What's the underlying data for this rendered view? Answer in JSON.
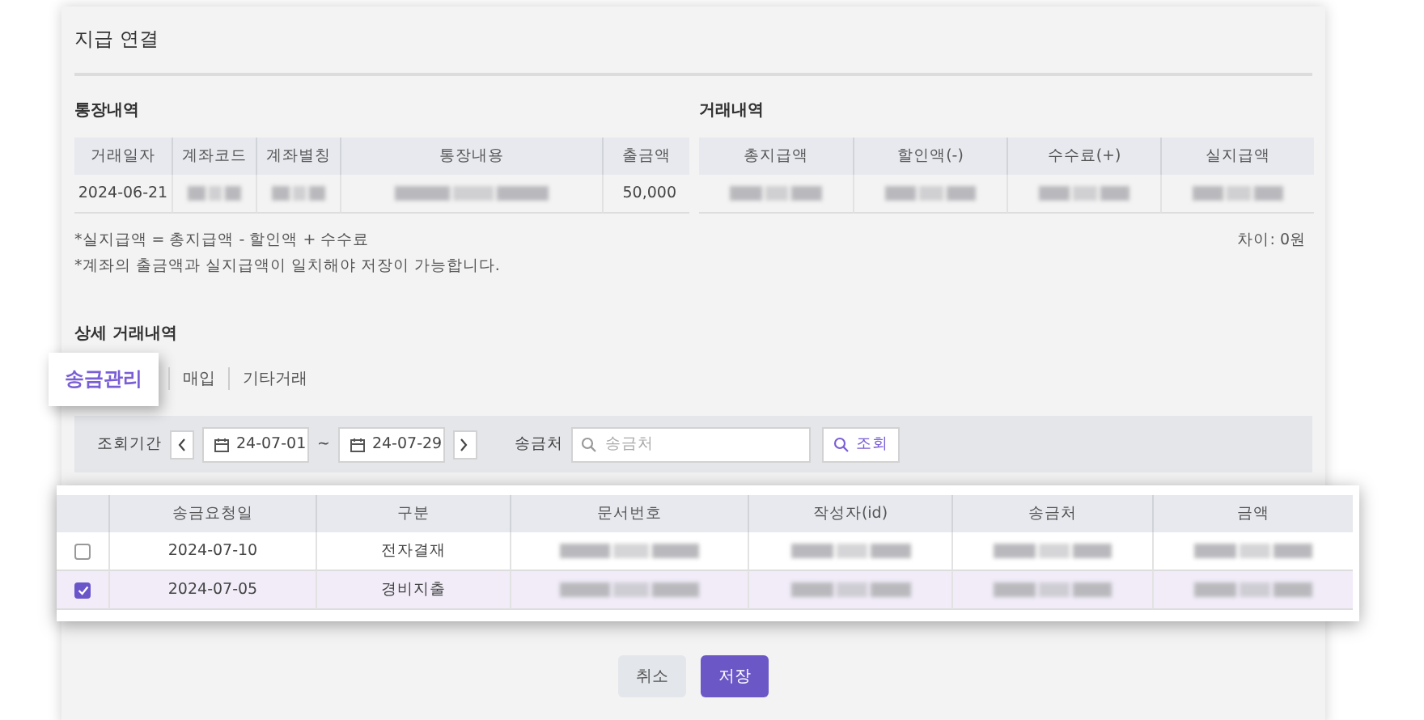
{
  "dialog": {
    "title": "지급 연결"
  },
  "bank_history": {
    "title": "통장내역",
    "columns": [
      "거래일자",
      "계좌코드",
      "계좌별칭",
      "통장내용",
      "출금액"
    ],
    "rows": [
      {
        "cells": [
          {
            "kind": "text",
            "text": "2024-06-21"
          },
          {
            "kind": "blurred"
          },
          {
            "kind": "blurred"
          },
          {
            "kind": "blurred"
          },
          {
            "kind": "amount",
            "text": "50,000"
          }
        ]
      }
    ]
  },
  "transaction_history": {
    "title": "거래내역",
    "columns": [
      "총지급액",
      "할인액(-)",
      "수수료(+)",
      "실지급액"
    ],
    "rows": [
      {
        "cells": [
          {
            "kind": "blurred"
          },
          {
            "kind": "blurred"
          },
          {
            "kind": "blurred"
          },
          {
            "kind": "blurred"
          }
        ]
      }
    ]
  },
  "notes": [
    "*실지급액 = 총지급액 - 할인액 + 수수료",
    "*계좌의 출금액과 실지급액이 일치해야 저장이 가능합니다."
  ],
  "difference": "차이: 0원",
  "detail": {
    "title": "상세 거래내역",
    "tabs": [
      {
        "label": "송금관리",
        "selected": true
      },
      {
        "label": "매입",
        "selected": false
      },
      {
        "label": "기타거래",
        "selected": false
      }
    ],
    "filter": {
      "period_label": "조회기간",
      "start_date": "24-07-01",
      "separator": "~",
      "end_date": "24-07-29",
      "payee_label": "송금처",
      "payee_placeholder": "송금처",
      "search_button": "조회"
    },
    "table": {
      "columns": [
        "송금요청일",
        "구분",
        "문서번호",
        "작성자(id)",
        "송금처",
        "금액"
      ],
      "rows": [
        {
          "checked": false,
          "cells": [
            {
              "kind": "text",
              "text": "2024-07-10"
            },
            {
              "kind": "text",
              "text": "전자결재"
            },
            {
              "kind": "blurred"
            },
            {
              "kind": "blurred"
            },
            {
              "kind": "blurred"
            },
            {
              "kind": "blurred"
            }
          ]
        },
        {
          "checked": true,
          "cells": [
            {
              "kind": "text",
              "text": "2024-07-05"
            },
            {
              "kind": "text",
              "text": "경비지출"
            },
            {
              "kind": "blurred"
            },
            {
              "kind": "blurred"
            },
            {
              "kind": "blurred"
            },
            {
              "kind": "blurred"
            }
          ]
        }
      ]
    }
  },
  "buttons": [
    {
      "label": "취소",
      "kind": "secondary"
    },
    {
      "label": "저장",
      "kind": "primary"
    }
  ]
}
